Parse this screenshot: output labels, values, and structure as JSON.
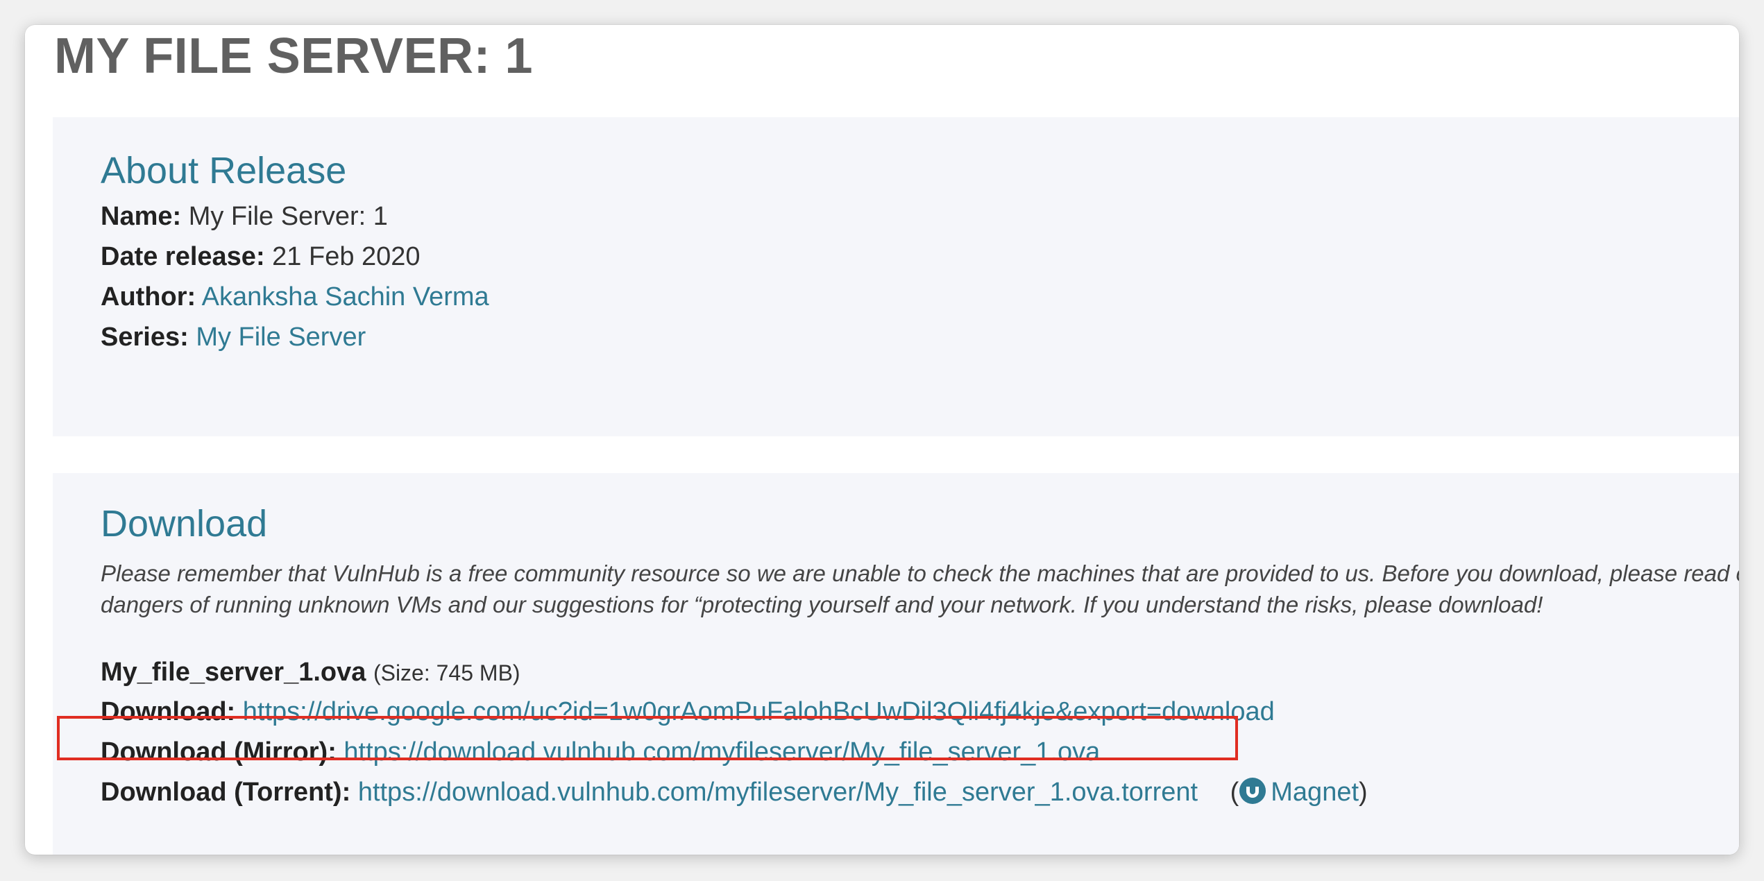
{
  "page": {
    "title": "MY FILE SERVER: 1"
  },
  "about": {
    "heading": "About Release",
    "name_label": "Name",
    "name_value": "My File Server: 1",
    "date_label": "Date release",
    "date_value": "21 Feb 2020",
    "author_label": "Author",
    "author_value": "Akanksha Sachin Verma",
    "series_label": "Series",
    "series_value": "My File Server"
  },
  "download": {
    "heading": "Download",
    "notice_line1": "Please remember that VulnHub is a free community resource so we are unable to check the machines that are provided to us. Before you download, please read our",
    "notice_line2": "dangers of running unknown VMs and our suggestions for “protecting yourself and your network. If you understand the risks, please download!",
    "file_name": "My_file_server_1.ova",
    "file_size": "(Size: 745 MB)",
    "download_label": "Download",
    "download_url": "https://drive.google.com/uc?id=1w0grAomPuFalohBcUwDil3Qli4fj4kje&export=download",
    "mirror_label": "Download (Mirror)",
    "mirror_url": "https://download.vulnhub.com/myfileserver/My_file_server_1.ova",
    "torrent_label": "Download (Torrent)",
    "torrent_url": "https://download.vulnhub.com/myfileserver/My_file_server_1.ova.torrent",
    "magnet_open": "(",
    "magnet_label": "Magnet",
    "magnet_close": ")",
    "magnet_icon": "magnet-icon"
  },
  "colors": {
    "link": "#2f7a93",
    "highlight": "#e02d22",
    "panel_bg": "#f5f6fa"
  }
}
